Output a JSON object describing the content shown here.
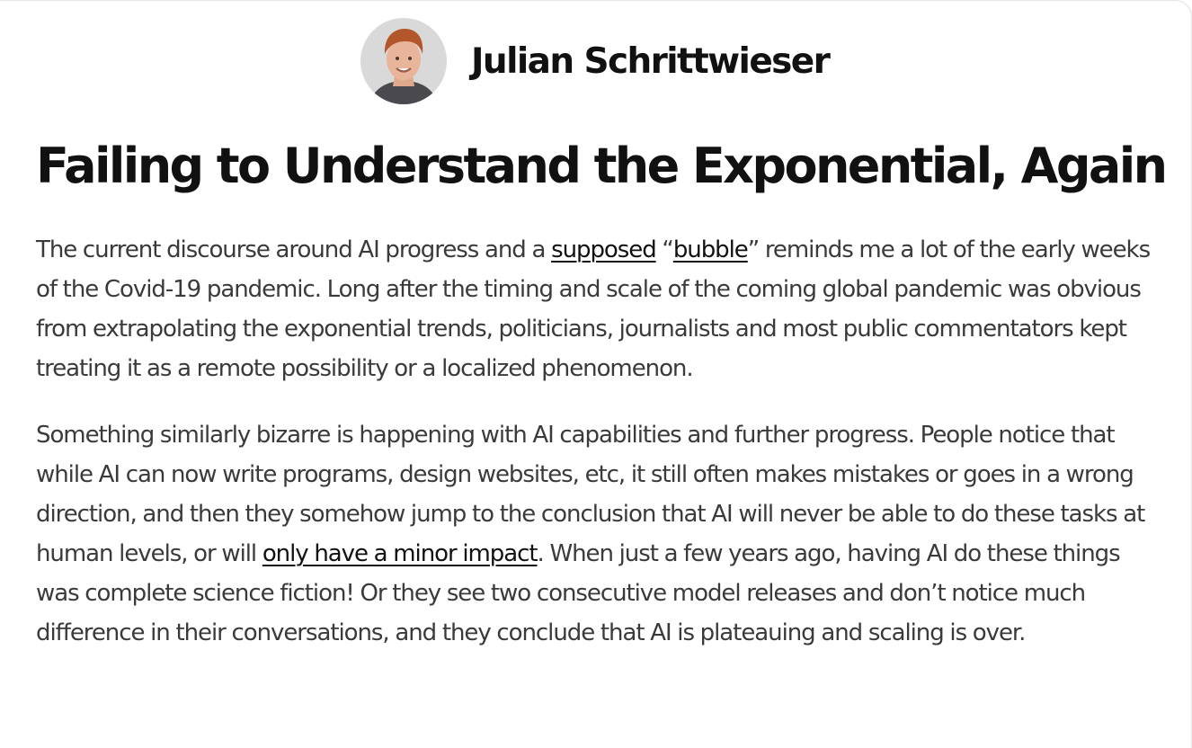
{
  "author": {
    "name": "Julian Schrittwieser"
  },
  "post": {
    "title": "Failing to Understand the Exponential, Again",
    "paragraphs": [
      {
        "t1": "The current discourse around AI progress and a ",
        "link1": "supposed",
        "t2": " “",
        "link2": "bubble",
        "t3": "” reminds me a lot of the early weeks of the Covid-19 pandemic. Long after the timing and scale of the coming global pandemic was obvious from extrapolating the exponential trends, politicians, journalists and most public commentators kept treating it as a remote possibility or a localized phenomenon."
      },
      {
        "t1": "Something similarly bizarre is happening with AI capabilities and further progress. People notice that while AI can now write programs, design websites, etc, it still often makes mistakes or goes in a wrong direction, and then they somehow jump to the conclusion that AI will never be able to do these tasks at human levels, or will ",
        "link1": "only have a minor impact",
        "t2": ". When just a few years ago, having AI do these things was complete science fiction! Or they see two consecutive model releases and don’t notice much difference in their conversations, and they conclude that AI is plateauing and scaling is over."
      }
    ]
  }
}
